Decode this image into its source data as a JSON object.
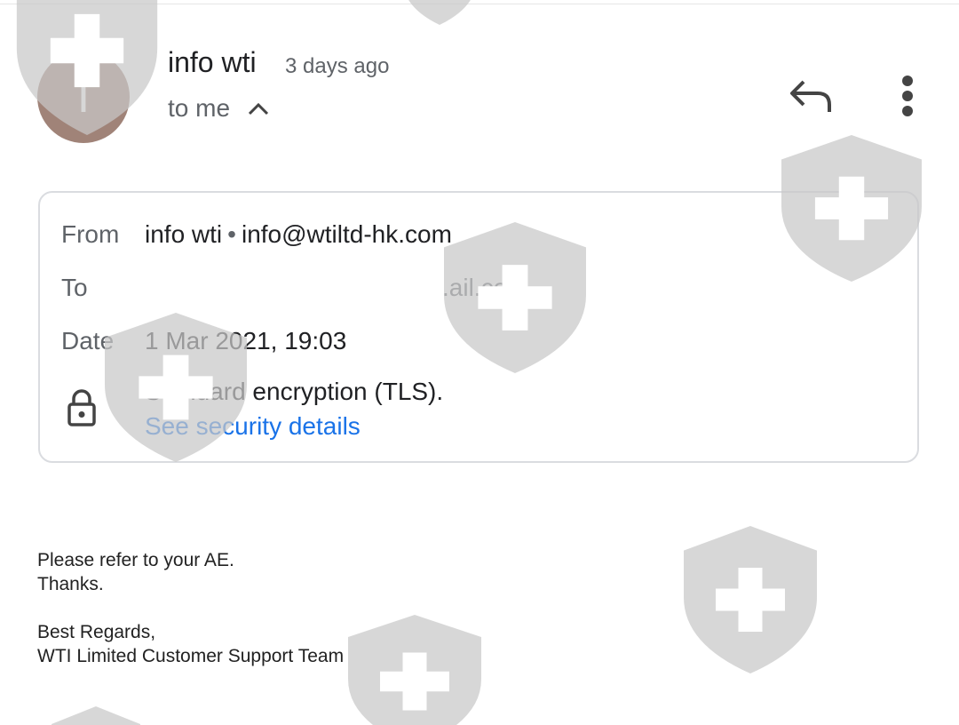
{
  "header": {
    "avatar_letter": "I",
    "sender_name": "info wti",
    "sent_time": "3 days ago",
    "recipient_summary": "to me",
    "icons": {
      "collapse": "chevron-up-icon",
      "reply": "reply-icon",
      "more": "more-vert-icon"
    }
  },
  "details": {
    "from_label": "From",
    "from_name": "info wti",
    "from_separator": "•",
    "from_email": "info@wtiltd-hk.com",
    "to_label": "To",
    "to_value": ".ail.com",
    "date_label": "Date",
    "date_value": "1 Mar 2021, 19:03",
    "encryption_text": "Standard encryption (TLS).",
    "security_link": "See security details",
    "icons": {
      "lock": "lock-icon"
    }
  },
  "body": {
    "line1": "Please refer to your AE.",
    "line2": "Thanks.",
    "line3": "Best Regards,",
    "line4": "WTI Limited Customer Support Team"
  },
  "colors": {
    "avatar": "#a08378",
    "link": "#1a73e8",
    "watermark": "#cfcfcf"
  }
}
